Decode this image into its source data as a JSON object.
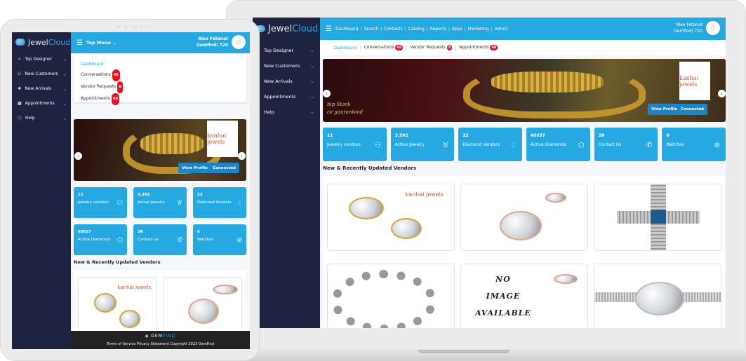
{
  "brand": {
    "name_part1": "Jewel",
    "name_part2": "Cloud"
  },
  "user": {
    "name": "Alex Fetanat",
    "account": "Gemfind| 720"
  },
  "desktop": {
    "top_nav": [
      "Dashboard",
      "Search",
      "Contacts",
      "Catalog",
      "Reports",
      "Apps",
      "Marketing",
      "Admin"
    ],
    "sidebar": [
      {
        "label": "Top Designer"
      },
      {
        "label": "New Customers"
      },
      {
        "label": "New Arrivals"
      },
      {
        "label": "Appointments"
      },
      {
        "label": "Help"
      }
    ],
    "subtabs": [
      {
        "label": "Dashboard",
        "badge": null
      },
      {
        "label": "Conversations",
        "badge": "45"
      },
      {
        "label": "Vendor Requests",
        "badge": "8"
      },
      {
        "label": "Appointments",
        "badge": "68"
      }
    ]
  },
  "banner": {
    "text_line1": "hip Stock",
    "text_line2": "ce gauranteed",
    "vendor_logo": "kanhai jewels",
    "view_profile": "View Profile",
    "connected": "Connected"
  },
  "stats": [
    {
      "value": "11",
      "label": "Jewelry vendors",
      "icon": "users-icon"
    },
    {
      "value": "3,592",
      "label": "Active Jewelry",
      "icon": "necklace-icon"
    },
    {
      "value": "22",
      "label": "Diamond Vendors",
      "icon": "diamond-icon"
    },
    {
      "value": "60037",
      "label": "Active Diamonds",
      "icon": "gem-ring-icon"
    },
    {
      "value": "38",
      "label": "Contact Us",
      "icon": "phone-icon"
    },
    {
      "value": "0",
      "label": "Watches",
      "icon": "watch-icon"
    }
  ],
  "vendors_section_title": "New & Recently Updated Vendors",
  "no_image": {
    "line1": "NO",
    "line2": "IMAGE",
    "line3": "AVAILABLE"
  },
  "tablet": {
    "top_menu": "Top Menu",
    "sidebar": [
      {
        "label": "Top Designer"
      },
      {
        "label": "New Customers"
      },
      {
        "label": "New Arrivals"
      },
      {
        "label": "Appointments"
      },
      {
        "label": "Help"
      }
    ],
    "footer_brand_part1": "GEM",
    "footer_brand_part2": "FIND",
    "footer_links": "Terms of Service   Privacy Statement   Copyright 2023 GemFind"
  },
  "colors": {
    "primary": "#26a9e0",
    "sidebar": "#1e2440",
    "badge": "#e5141c",
    "button": "#1a86c7"
  }
}
